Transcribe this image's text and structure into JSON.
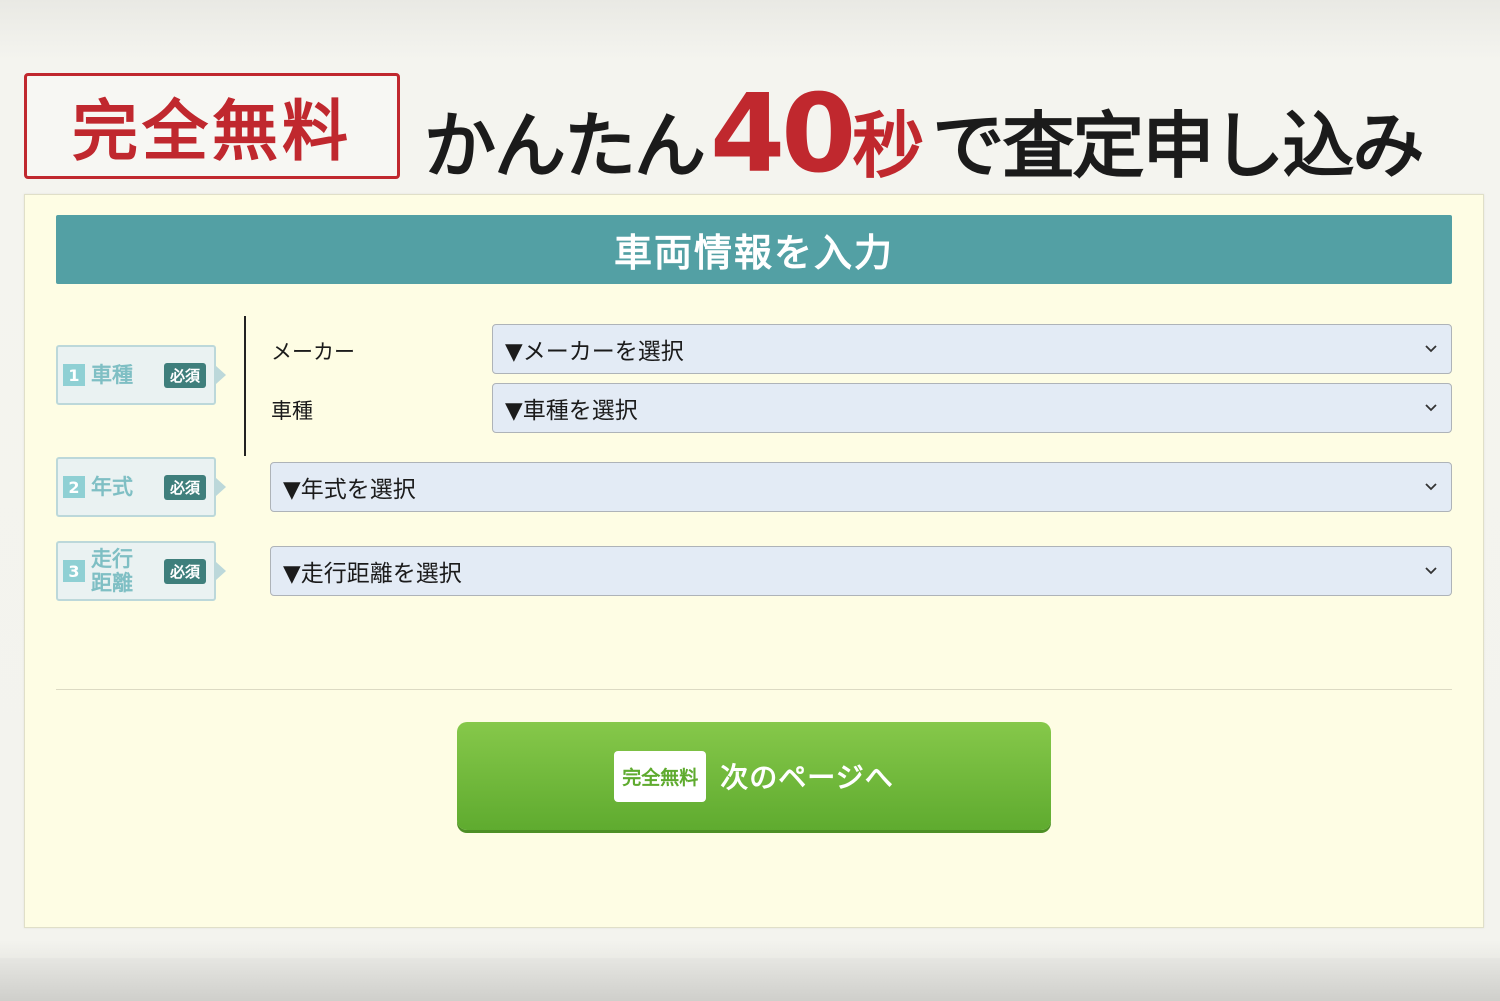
{
  "header": {
    "free_badge": "完全無料",
    "headline_pre": "かんたん",
    "headline_number": "40",
    "headline_unit": "秒",
    "headline_post": "で査定申し込み"
  },
  "form": {
    "section_title": "車両情報を入力",
    "required_label": "必須",
    "steps": [
      {
        "number": "1",
        "label": "車種",
        "fields": [
          {
            "label": "メーカー",
            "value": "▼メーカーを選択"
          },
          {
            "label": "車種",
            "value": "▼車種を選択"
          }
        ]
      },
      {
        "number": "2",
        "label": "年式",
        "value": "▼年式を選択"
      },
      {
        "number": "3",
        "label": "走行 距離",
        "value": "▼走行距離を選択"
      }
    ],
    "submit": {
      "badge": "完全無料",
      "label": "次のページへ"
    }
  },
  "icons": {
    "select_arrow": "chevron-down-icon"
  },
  "colors": {
    "accent_red": "#c0282e",
    "section_teal": "#53a0a4",
    "button_green": "#6fbb3a",
    "panel_bg": "#fefde4"
  }
}
